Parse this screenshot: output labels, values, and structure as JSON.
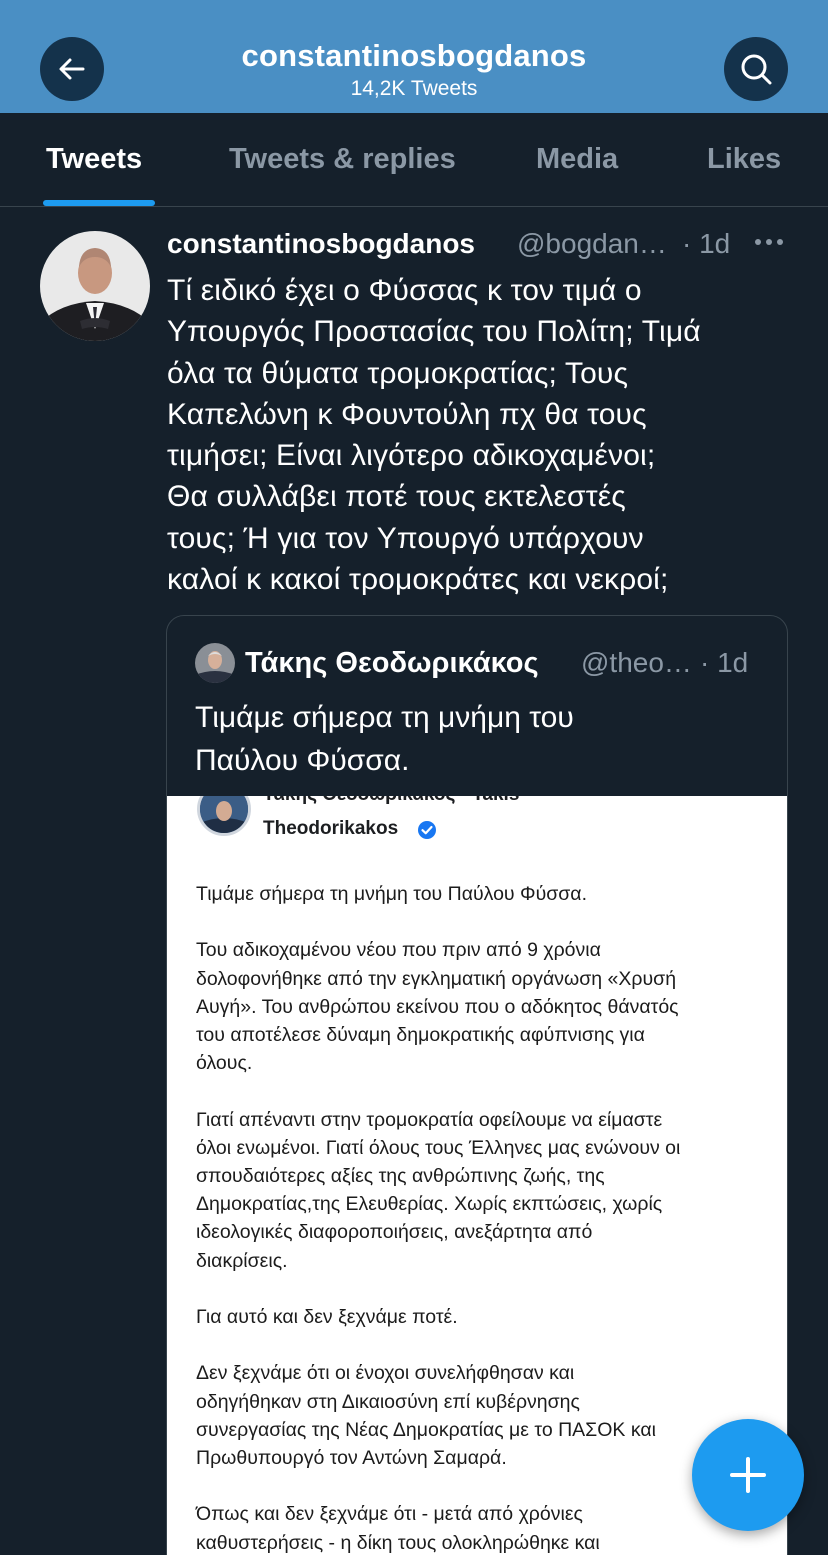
{
  "header": {
    "title": "constantinosbogdanos",
    "subtitle": "14,2K Tweets",
    "back_icon": "arrow-left-icon",
    "search_icon": "search-icon",
    "color": "#4a8fc4"
  },
  "tabs": [
    {
      "label": "Tweets",
      "active": true
    },
    {
      "label": "Tweets & replies",
      "active": false
    },
    {
      "label": "Media",
      "active": false
    },
    {
      "label": "Likes",
      "active": false
    }
  ],
  "tweet": {
    "name": "constantinosbogdanos",
    "handle": "@bogdan…",
    "time": "· 1d",
    "more_icon": "more-horizontal-icon",
    "lines": [
      "Τί ειδικό έχει ο Φύσσας κ τον τιμά ο",
      "Υπουργός Προστασίας του Πολίτη; Τιμά",
      "όλα τα θύματα τρομοκρατίας; Τους",
      "Καπελώνη κ Φουντούλη πχ θα τους",
      "τιμήσει; Είναι λιγότερο αδικοχαμένοι;",
      "Θα συλλάβει ποτέ τους εκτελεστές",
      "τους; Ή για τον Υπουργό υπάρχουν",
      "καλοί κ κακοί τρομοκράτες και νεκροί;"
    ]
  },
  "quote": {
    "name": "Τάκης Θεοδωρικάκος",
    "handle": "@theo…",
    "time": "· 1d",
    "lines": [
      "Τιμάμε σήμερα τη μνήμη του",
      "Παύλου Φύσσα."
    ],
    "image": {
      "author_line1": "Τάκης Θεοδωρικάκος - Takis",
      "author_line2": "Theodorikakos",
      "verified_icon": "verified-badge-icon",
      "paragraphs": [
        [
          "Τιμάμε σήμερα τη μνήμη του Παύλου Φύσσα."
        ],
        [
          "Του αδικοχαμένου νέου που πριν από 9 χρόνια",
          "δολοφονήθηκε από την εγκληματική οργάνωση «Χρυσή",
          "Αυγή». Του ανθρώπου εκείνου που ο αδόκητος θάνατός",
          "του αποτέλεσε δύναμη δημοκρατικής αφύπνισης για",
          "όλους."
        ],
        [
          "Γιατί απέναντι στην τρομοκρατία οφείλουμε να είμαστε",
          "όλοι ενωμένοι. Γιατί όλους τους Έλληνες μας ενώνουν οι",
          "σπουδαιότερες αξίες της ανθρώπινης ζωής, της",
          "Δημοκρατίας,της Ελευθερίας. Χωρίς εκπτώσεις, χωρίς",
          "ιδεολογικές διαφοροποιήσεις, ανεξάρτητα από",
          "διακρίσεις."
        ],
        [
          "Για αυτό και δεν ξεχνάμε ποτέ."
        ],
        [
          "Δεν ξεχνάμε ότι οι ένοχοι συνελήφθησαν και",
          "οδηγήθηκαν στη Δικαιοσύνη επί κυβέρνησης",
          "συνεργασίας της Νέας Δημοκρατίας με το ΠΑΣΟΚ και",
          "Πρωθυπουργό τον Αντώνη Σαμαρά."
        ],
        [
          "Όπως και δεν ξεχνάμε ότι - μετά από χρόνιες",
          "καθυστερήσεις - η δίκη τους ολοκληρώθηκε και"
        ]
      ]
    }
  },
  "fab": {
    "icon": "compose-plus-icon",
    "color": "#1d9bf0"
  }
}
